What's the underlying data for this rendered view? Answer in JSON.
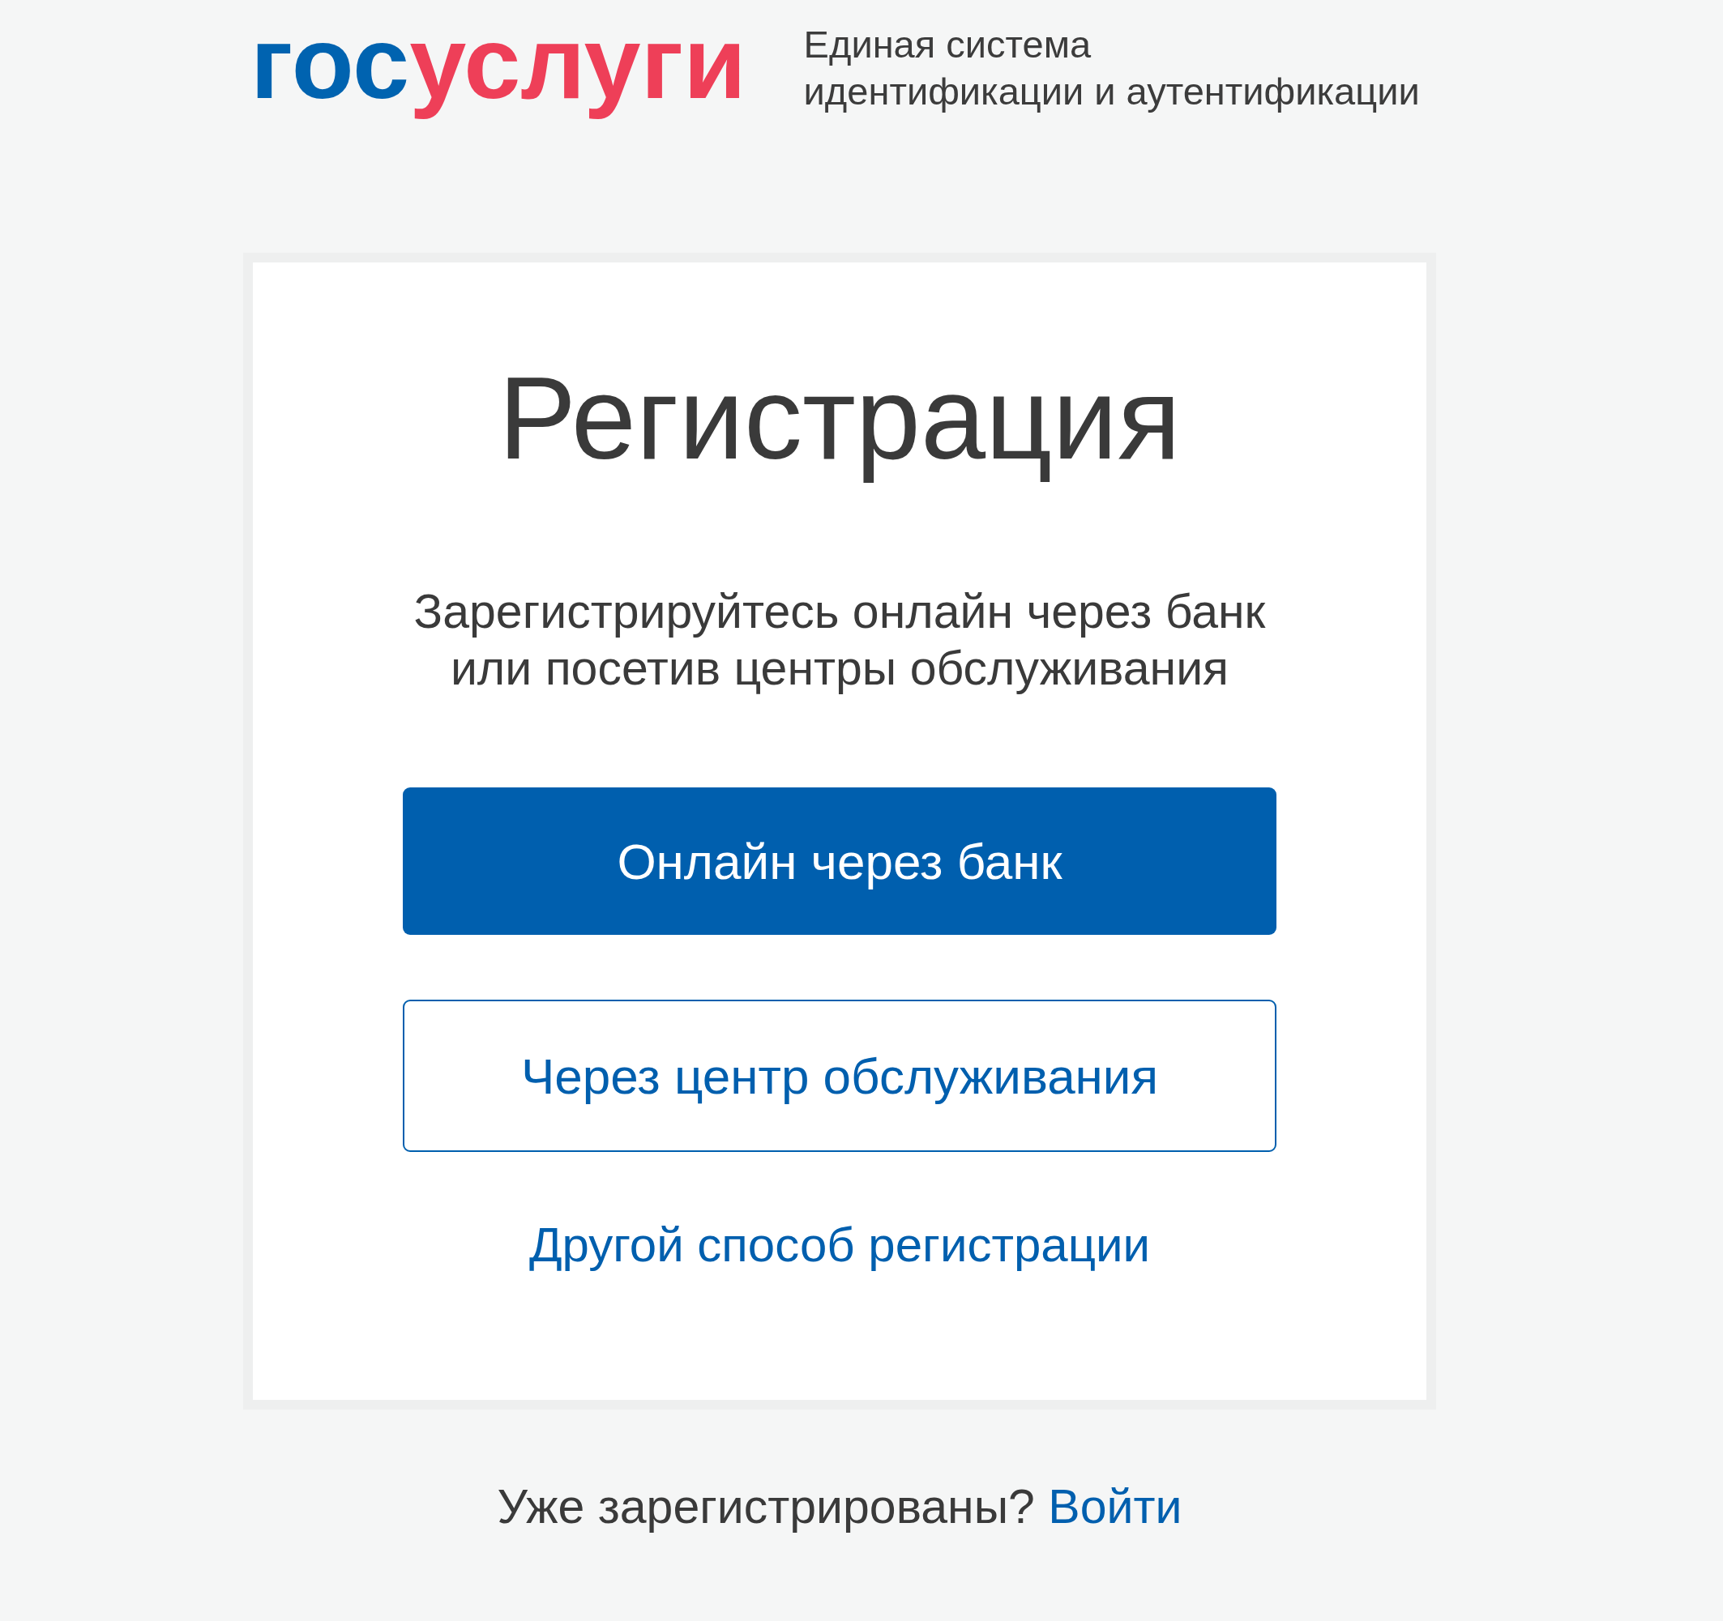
{
  "header": {
    "logo": {
      "parts": [
        {
          "text": "гос",
          "color": "#0063b0"
        },
        {
          "text": "услуги",
          "color": "#ee3f58"
        }
      ]
    },
    "tagline": [
      "Единая система",
      "идентификации и аутентификации"
    ]
  },
  "card": {
    "title": "Регистрация",
    "subtitle": [
      "Зарегистрируйтесь онлайн через банк",
      "или посетив центры обслуживания"
    ],
    "buttons": [
      {
        "label": "Онлайн через банк",
        "kind": "primary"
      },
      {
        "label": "Через центр обслуживания",
        "kind": "outline"
      }
    ],
    "link": "Другой способ регистрации"
  },
  "footer": {
    "text": "Уже зарегистрированы?",
    "link": "Войти"
  }
}
